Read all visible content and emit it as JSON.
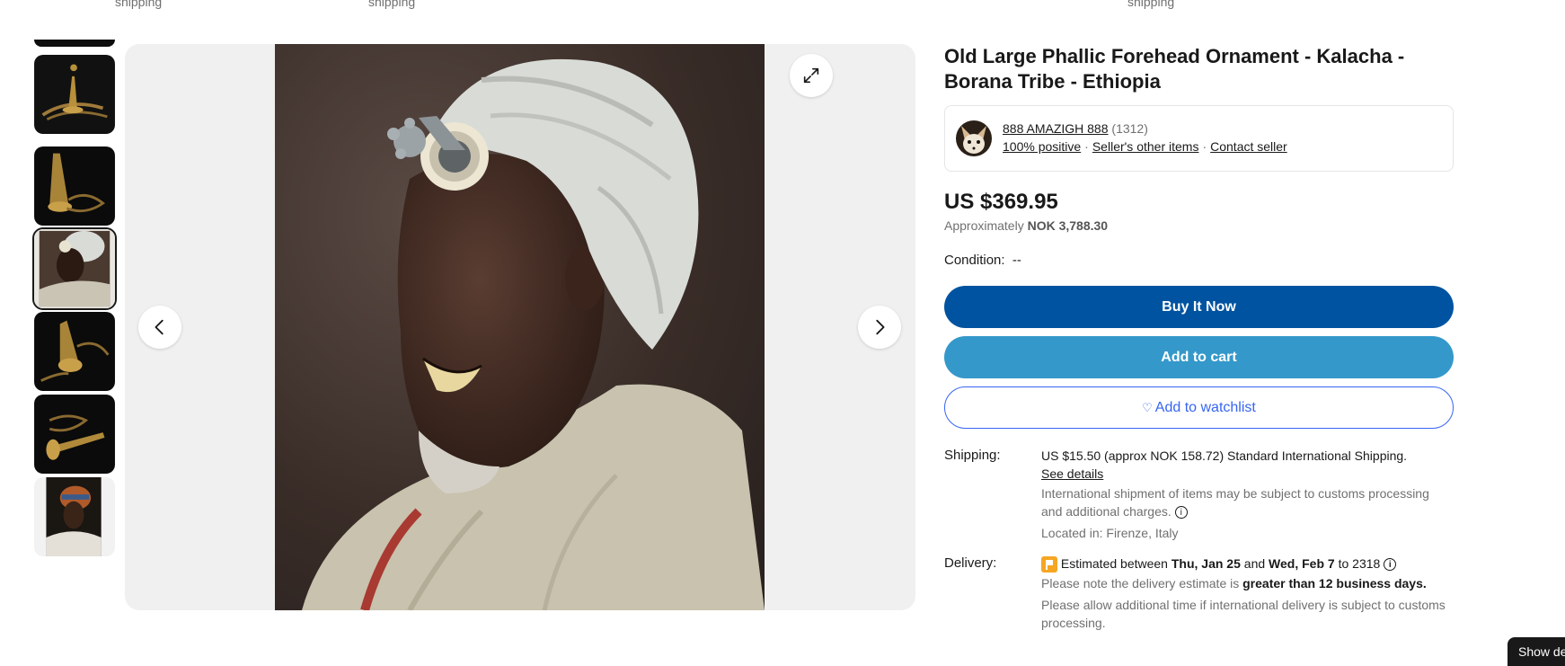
{
  "top_strip": [
    "shipping",
    "shipping",
    "shipping"
  ],
  "gallery": {
    "thumbnails": [
      {
        "subject": "brass ornament upright"
      },
      {
        "subject": "brass ornament angled"
      },
      {
        "subject": "man wearing ornament",
        "selected": true
      },
      {
        "subject": "brass ornament side"
      },
      {
        "subject": "brass ornament lying"
      },
      {
        "subject": "man in headdress"
      }
    ],
    "icons": {
      "expand": "expand-icon",
      "prev": "chevron-left-icon",
      "next": "chevron-right-icon"
    }
  },
  "listing": {
    "title": "Old Large Phallic Forehead Ornament - Kalacha - Borana Tribe - Ethiopia",
    "seller": {
      "name": "888 AMAZIGH 888",
      "feedback_count": "(1312)",
      "positive": "100% positive",
      "other_items": "Seller's other items",
      "contact": "Contact seller"
    },
    "price": "US $369.95",
    "approx_prefix": "Approximately",
    "approx_value": "NOK 3,788.30",
    "condition_label": "Condition:",
    "condition_value": "--",
    "buttons": {
      "buy": "Buy It Now",
      "cart": "Add to cart",
      "watch": "Add to watchlist"
    },
    "shipping": {
      "label": "Shipping:",
      "cost": "US $15.50 (approx NOK 158.72)",
      "method": "Standard International Shipping.",
      "details_link": "See details",
      "customs_note": "International shipment of items may be subject to customs processing and additional charges.",
      "location": "Located in: Firenze, Italy"
    },
    "delivery": {
      "label": "Delivery:",
      "estimate_prefix": "Estimated between",
      "date_start": "Thu, Jan 25",
      "and": "and",
      "date_end": "Wed, Feb 7",
      "to": "to",
      "zip": "2318",
      "note_prefix": "Please note the delivery estimate is",
      "note_bold": "greater than 12 business days.",
      "allow_note": "Please allow additional time if international delivery is subject to customs processing."
    }
  },
  "show_tab": "Show de",
  "colors": {
    "buy": "#0053a0",
    "cart": "#3498ca",
    "watch": "#3665f3"
  }
}
